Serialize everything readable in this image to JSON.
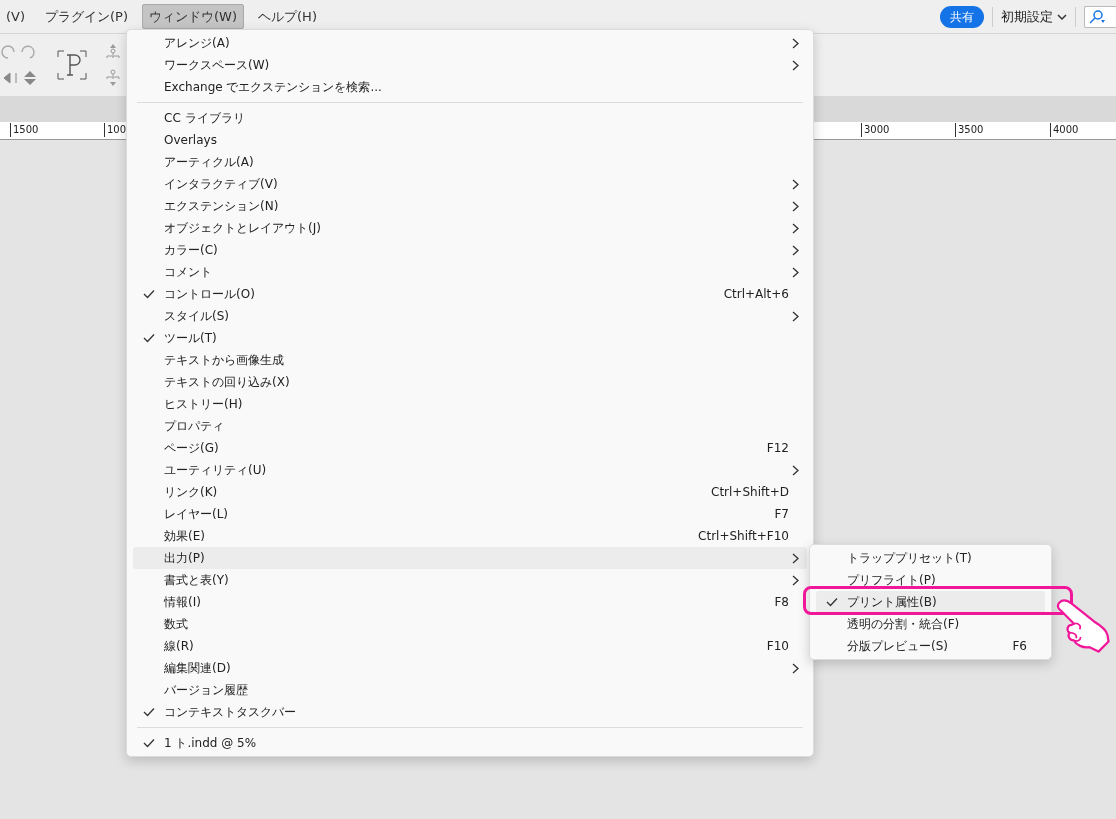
{
  "menubar": [
    {
      "label": "(V)",
      "selected": false
    },
    {
      "label": "プラグイン(P)",
      "selected": false
    },
    {
      "label": "ウィンドウ(W)",
      "selected": true
    },
    {
      "label": "ヘルプ(H)",
      "selected": false
    }
  ],
  "header_right": {
    "share_button": "共有",
    "workspace": "初期設定"
  },
  "ruler": [
    "1500",
    "100",
    "3000",
    "3500",
    "4000"
  ],
  "menu": [
    {
      "kind": "item",
      "label": "アレンジ(A)",
      "checked": false,
      "submenu": true,
      "selected": false
    },
    {
      "kind": "item",
      "label": "ワークスペース(W)",
      "checked": false,
      "submenu": true,
      "selected": false
    },
    {
      "kind": "item",
      "label": "Exchange でエクステンションを検索...",
      "checked": false,
      "submenu": false,
      "selected": false
    },
    {
      "kind": "separator"
    },
    {
      "kind": "item",
      "label": "CC ライブラリ",
      "checked": false,
      "submenu": false,
      "selected": false
    },
    {
      "kind": "item",
      "label": "Overlays",
      "checked": false,
      "submenu": false,
      "selected": false
    },
    {
      "kind": "item",
      "label": "アーティクル(A)",
      "checked": false,
      "submenu": false,
      "selected": false
    },
    {
      "kind": "item",
      "label": "インタラクティブ(V)",
      "checked": false,
      "submenu": true,
      "selected": false
    },
    {
      "kind": "item",
      "label": "エクステンション(N)",
      "checked": false,
      "submenu": true,
      "selected": false
    },
    {
      "kind": "item",
      "label": "オブジェクトとレイアウト(J)",
      "checked": false,
      "submenu": true,
      "selected": false
    },
    {
      "kind": "item",
      "label": "カラー(C)",
      "checked": false,
      "submenu": true,
      "selected": false
    },
    {
      "kind": "item",
      "label": "コメント",
      "checked": false,
      "submenu": true,
      "selected": false
    },
    {
      "kind": "item",
      "label": "コントロール(O)",
      "checked": true,
      "shortcut": "Ctrl+Alt+6",
      "submenu": false,
      "selected": false
    },
    {
      "kind": "item",
      "label": "スタイル(S)",
      "checked": false,
      "submenu": true,
      "selected": false
    },
    {
      "kind": "item",
      "label": "ツール(T)",
      "checked": true,
      "submenu": false,
      "selected": false
    },
    {
      "kind": "item",
      "label": "テキストから画像生成",
      "checked": false,
      "submenu": false,
      "selected": false
    },
    {
      "kind": "item",
      "label": "テキストの回り込み(X)",
      "checked": false,
      "submenu": false,
      "selected": false
    },
    {
      "kind": "item",
      "label": "ヒストリー(H)",
      "checked": false,
      "submenu": false,
      "selected": false
    },
    {
      "kind": "item",
      "label": "プロパティ",
      "checked": false,
      "submenu": false,
      "selected": false
    },
    {
      "kind": "item",
      "label": "ページ(G)",
      "checked": false,
      "shortcut": "F12",
      "submenu": false,
      "selected": false
    },
    {
      "kind": "item",
      "label": "ユーティリティ(U)",
      "checked": false,
      "submenu": true,
      "selected": false
    },
    {
      "kind": "item",
      "label": "リンク(K)",
      "checked": false,
      "shortcut": "Ctrl+Shift+D",
      "submenu": false,
      "selected": false
    },
    {
      "kind": "item",
      "label": "レイヤー(L)",
      "checked": false,
      "shortcut": "F7",
      "submenu": false,
      "selected": false
    },
    {
      "kind": "item",
      "label": "効果(E)",
      "checked": false,
      "shortcut": "Ctrl+Shift+F10",
      "submenu": false,
      "selected": false
    },
    {
      "kind": "item",
      "label": "出力(P)",
      "checked": false,
      "submenu": true,
      "selected": true
    },
    {
      "kind": "item",
      "label": "書式と表(Y)",
      "checked": false,
      "submenu": true,
      "selected": false
    },
    {
      "kind": "item",
      "label": "情報(I)",
      "checked": false,
      "shortcut": "F8",
      "submenu": false,
      "selected": false
    },
    {
      "kind": "item",
      "label": "数式",
      "checked": false,
      "submenu": false,
      "selected": false
    },
    {
      "kind": "item",
      "label": "線(R)",
      "checked": false,
      "shortcut": "F10",
      "submenu": false,
      "selected": false
    },
    {
      "kind": "item",
      "label": "編集関連(D)",
      "checked": false,
      "submenu": true,
      "selected": false
    },
    {
      "kind": "item",
      "label": "バージョン履歴",
      "checked": false,
      "submenu": false,
      "selected": false
    },
    {
      "kind": "item",
      "label": "コンテキストタスクバー",
      "checked": true,
      "submenu": false,
      "selected": false
    },
    {
      "kind": "separator"
    },
    {
      "kind": "item",
      "label": "1 ト.indd @ 5%",
      "checked": true,
      "submenu": false,
      "selected": false
    }
  ],
  "submenu": [
    {
      "kind": "item",
      "label": "トラッププリセット(T)",
      "checked": false,
      "submenu": false,
      "selected": false
    },
    {
      "kind": "item",
      "label": "プリフライト(P)",
      "checked": false,
      "submenu": false,
      "selected": false
    },
    {
      "kind": "item",
      "label": "プリント属性(B)",
      "checked": true,
      "submenu": false,
      "selected": true
    },
    {
      "kind": "item",
      "label": "透明の分割・統合(F)",
      "checked": false,
      "submenu": false,
      "selected": false
    },
    {
      "kind": "item",
      "label": "分版プレビュー(S)",
      "checked": false,
      "shortcut": "F6",
      "submenu": false,
      "selected": false
    }
  ]
}
